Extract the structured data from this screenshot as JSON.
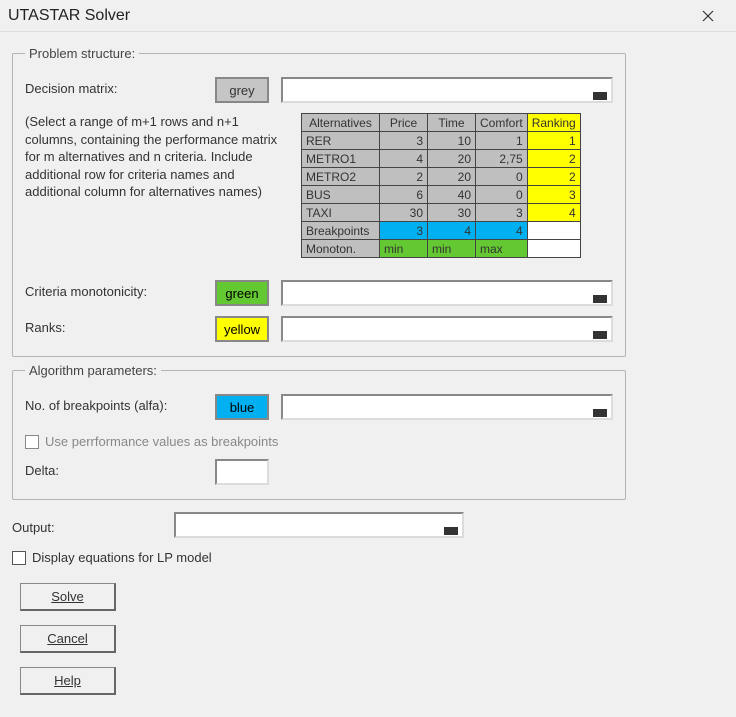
{
  "window": {
    "title": "UTASTAR Solver"
  },
  "groups": {
    "structure": "Problem structure:",
    "algorithm": "Algorithm parameters:"
  },
  "labels": {
    "decision_matrix": "Decision matrix:",
    "monotonicity": "Criteria monotonicity:",
    "ranks": "Ranks:",
    "breakpoints": "No. of breakpoints (alfa):",
    "delta": "Delta:",
    "output": "Output:",
    "use_perf": "Use perrformance values as breakpoints",
    "display_eq": "Display equations for LP model"
  },
  "swatches": {
    "grey": "grey",
    "green": "green",
    "yellow": "yellow",
    "blue": "blue"
  },
  "hint": "(Select a range of m+1 rows and n+1 columns, containing the performance matrix for m alternatives and n criteria. Include additional row for criteria names and additional column for alternatives names)",
  "matrix": {
    "headers": [
      "Alternatives",
      "Price",
      "Time",
      "Comfort",
      "Ranking"
    ],
    "rows": [
      {
        "name": "RER",
        "vals": [
          "3",
          "10",
          "1"
        ],
        "rank": "1"
      },
      {
        "name": "METRO1",
        "vals": [
          "4",
          "20",
          "2,75"
        ],
        "rank": "2"
      },
      {
        "name": "METRO2",
        "vals": [
          "2",
          "20",
          "0"
        ],
        "rank": "2"
      },
      {
        "name": "BUS",
        "vals": [
          "6",
          "40",
          "0"
        ],
        "rank": "3"
      },
      {
        "name": "TAXI",
        "vals": [
          "30",
          "30",
          "3"
        ],
        "rank": "4"
      }
    ],
    "breakpoints_label": "Breakpoints",
    "breakpoints": [
      "3",
      "4",
      "4"
    ],
    "mono_label": "Monoton.",
    "mono": [
      "min",
      "min",
      "max"
    ]
  },
  "buttons": {
    "solve": "Solve",
    "cancel": "Cancel",
    "help": "Help"
  }
}
